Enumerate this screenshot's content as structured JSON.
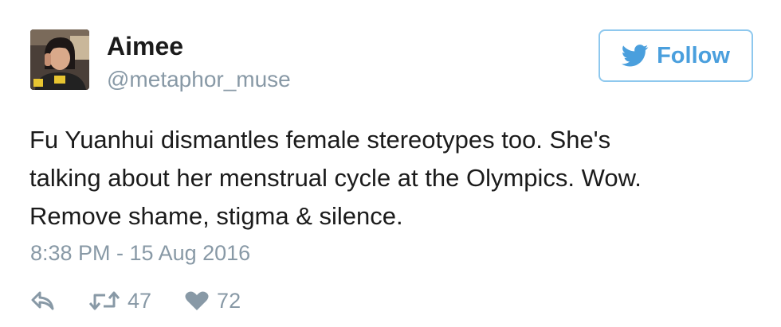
{
  "user": {
    "name": "Aimee",
    "handle": "@metaphor_muse"
  },
  "follow_button": {
    "label": "Follow",
    "icon": "twitter-bird-icon",
    "color": "#4a9fdd"
  },
  "tweet": {
    "lines": [
      "Fu Yuanhui dismantles female stereotypes too. She's",
      "talking about her menstrual cycle at the Olympics. Wow.",
      "Remove shame, stigma & silence."
    ],
    "timestamp": "8:38 PM - 15 Aug 2016"
  },
  "actions": {
    "reply": {
      "icon": "reply-icon"
    },
    "retweet": {
      "icon": "retweet-icon",
      "count": "47"
    },
    "like": {
      "icon": "heart-icon",
      "count": "72"
    }
  }
}
